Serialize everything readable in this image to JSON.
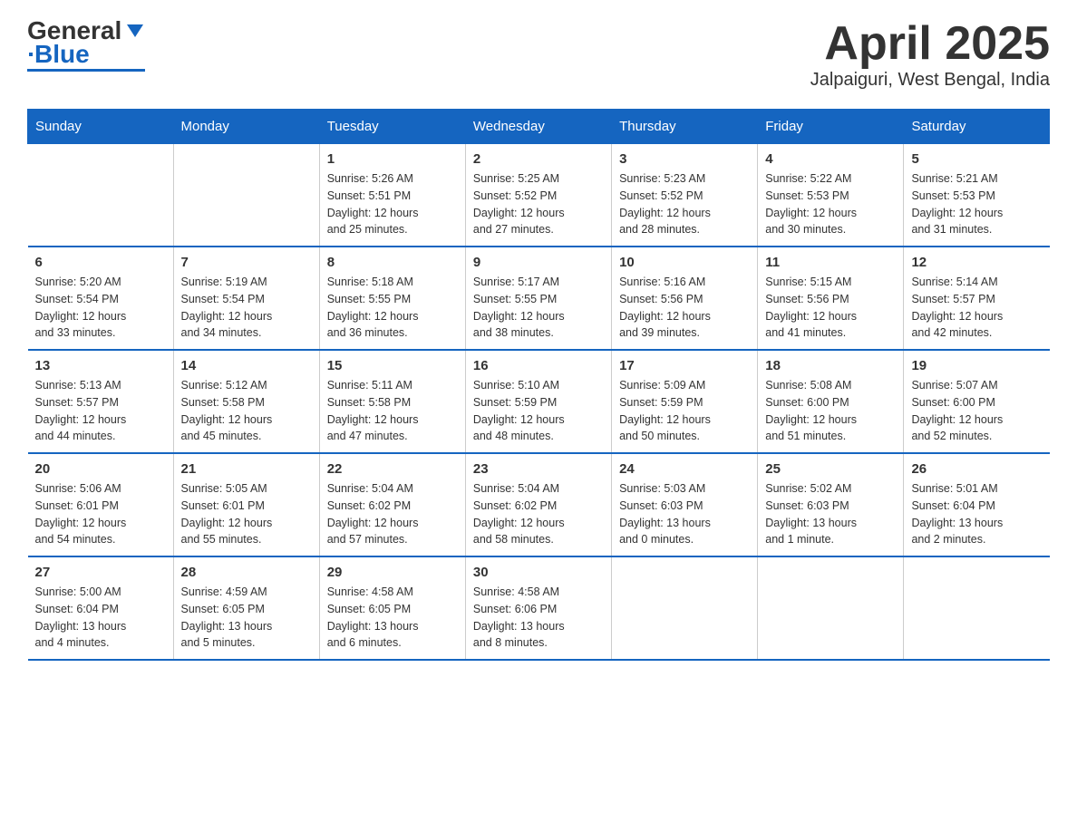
{
  "logo": {
    "text_general": "General",
    "text_blue": "Blue",
    "alt": "GeneralBlue logo"
  },
  "title": "April 2025",
  "location": "Jalpaiguri, West Bengal, India",
  "days_of_week": [
    "Sunday",
    "Monday",
    "Tuesday",
    "Wednesday",
    "Thursday",
    "Friday",
    "Saturday"
  ],
  "weeks": [
    [
      {
        "day": "",
        "info": ""
      },
      {
        "day": "",
        "info": ""
      },
      {
        "day": "1",
        "info": "Sunrise: 5:26 AM\nSunset: 5:51 PM\nDaylight: 12 hours\nand 25 minutes."
      },
      {
        "day": "2",
        "info": "Sunrise: 5:25 AM\nSunset: 5:52 PM\nDaylight: 12 hours\nand 27 minutes."
      },
      {
        "day": "3",
        "info": "Sunrise: 5:23 AM\nSunset: 5:52 PM\nDaylight: 12 hours\nand 28 minutes."
      },
      {
        "day": "4",
        "info": "Sunrise: 5:22 AM\nSunset: 5:53 PM\nDaylight: 12 hours\nand 30 minutes."
      },
      {
        "day": "5",
        "info": "Sunrise: 5:21 AM\nSunset: 5:53 PM\nDaylight: 12 hours\nand 31 minutes."
      }
    ],
    [
      {
        "day": "6",
        "info": "Sunrise: 5:20 AM\nSunset: 5:54 PM\nDaylight: 12 hours\nand 33 minutes."
      },
      {
        "day": "7",
        "info": "Sunrise: 5:19 AM\nSunset: 5:54 PM\nDaylight: 12 hours\nand 34 minutes."
      },
      {
        "day": "8",
        "info": "Sunrise: 5:18 AM\nSunset: 5:55 PM\nDaylight: 12 hours\nand 36 minutes."
      },
      {
        "day": "9",
        "info": "Sunrise: 5:17 AM\nSunset: 5:55 PM\nDaylight: 12 hours\nand 38 minutes."
      },
      {
        "day": "10",
        "info": "Sunrise: 5:16 AM\nSunset: 5:56 PM\nDaylight: 12 hours\nand 39 minutes."
      },
      {
        "day": "11",
        "info": "Sunrise: 5:15 AM\nSunset: 5:56 PM\nDaylight: 12 hours\nand 41 minutes."
      },
      {
        "day": "12",
        "info": "Sunrise: 5:14 AM\nSunset: 5:57 PM\nDaylight: 12 hours\nand 42 minutes."
      }
    ],
    [
      {
        "day": "13",
        "info": "Sunrise: 5:13 AM\nSunset: 5:57 PM\nDaylight: 12 hours\nand 44 minutes."
      },
      {
        "day": "14",
        "info": "Sunrise: 5:12 AM\nSunset: 5:58 PM\nDaylight: 12 hours\nand 45 minutes."
      },
      {
        "day": "15",
        "info": "Sunrise: 5:11 AM\nSunset: 5:58 PM\nDaylight: 12 hours\nand 47 minutes."
      },
      {
        "day": "16",
        "info": "Sunrise: 5:10 AM\nSunset: 5:59 PM\nDaylight: 12 hours\nand 48 minutes."
      },
      {
        "day": "17",
        "info": "Sunrise: 5:09 AM\nSunset: 5:59 PM\nDaylight: 12 hours\nand 50 minutes."
      },
      {
        "day": "18",
        "info": "Sunrise: 5:08 AM\nSunset: 6:00 PM\nDaylight: 12 hours\nand 51 minutes."
      },
      {
        "day": "19",
        "info": "Sunrise: 5:07 AM\nSunset: 6:00 PM\nDaylight: 12 hours\nand 52 minutes."
      }
    ],
    [
      {
        "day": "20",
        "info": "Sunrise: 5:06 AM\nSunset: 6:01 PM\nDaylight: 12 hours\nand 54 minutes."
      },
      {
        "day": "21",
        "info": "Sunrise: 5:05 AM\nSunset: 6:01 PM\nDaylight: 12 hours\nand 55 minutes."
      },
      {
        "day": "22",
        "info": "Sunrise: 5:04 AM\nSunset: 6:02 PM\nDaylight: 12 hours\nand 57 minutes."
      },
      {
        "day": "23",
        "info": "Sunrise: 5:04 AM\nSunset: 6:02 PM\nDaylight: 12 hours\nand 58 minutes."
      },
      {
        "day": "24",
        "info": "Sunrise: 5:03 AM\nSunset: 6:03 PM\nDaylight: 13 hours\nand 0 minutes."
      },
      {
        "day": "25",
        "info": "Sunrise: 5:02 AM\nSunset: 6:03 PM\nDaylight: 13 hours\nand 1 minute."
      },
      {
        "day": "26",
        "info": "Sunrise: 5:01 AM\nSunset: 6:04 PM\nDaylight: 13 hours\nand 2 minutes."
      }
    ],
    [
      {
        "day": "27",
        "info": "Sunrise: 5:00 AM\nSunset: 6:04 PM\nDaylight: 13 hours\nand 4 minutes."
      },
      {
        "day": "28",
        "info": "Sunrise: 4:59 AM\nSunset: 6:05 PM\nDaylight: 13 hours\nand 5 minutes."
      },
      {
        "day": "29",
        "info": "Sunrise: 4:58 AM\nSunset: 6:05 PM\nDaylight: 13 hours\nand 6 minutes."
      },
      {
        "day": "30",
        "info": "Sunrise: 4:58 AM\nSunset: 6:06 PM\nDaylight: 13 hours\nand 8 minutes."
      },
      {
        "day": "",
        "info": ""
      },
      {
        "day": "",
        "info": ""
      },
      {
        "day": "",
        "info": ""
      }
    ]
  ]
}
